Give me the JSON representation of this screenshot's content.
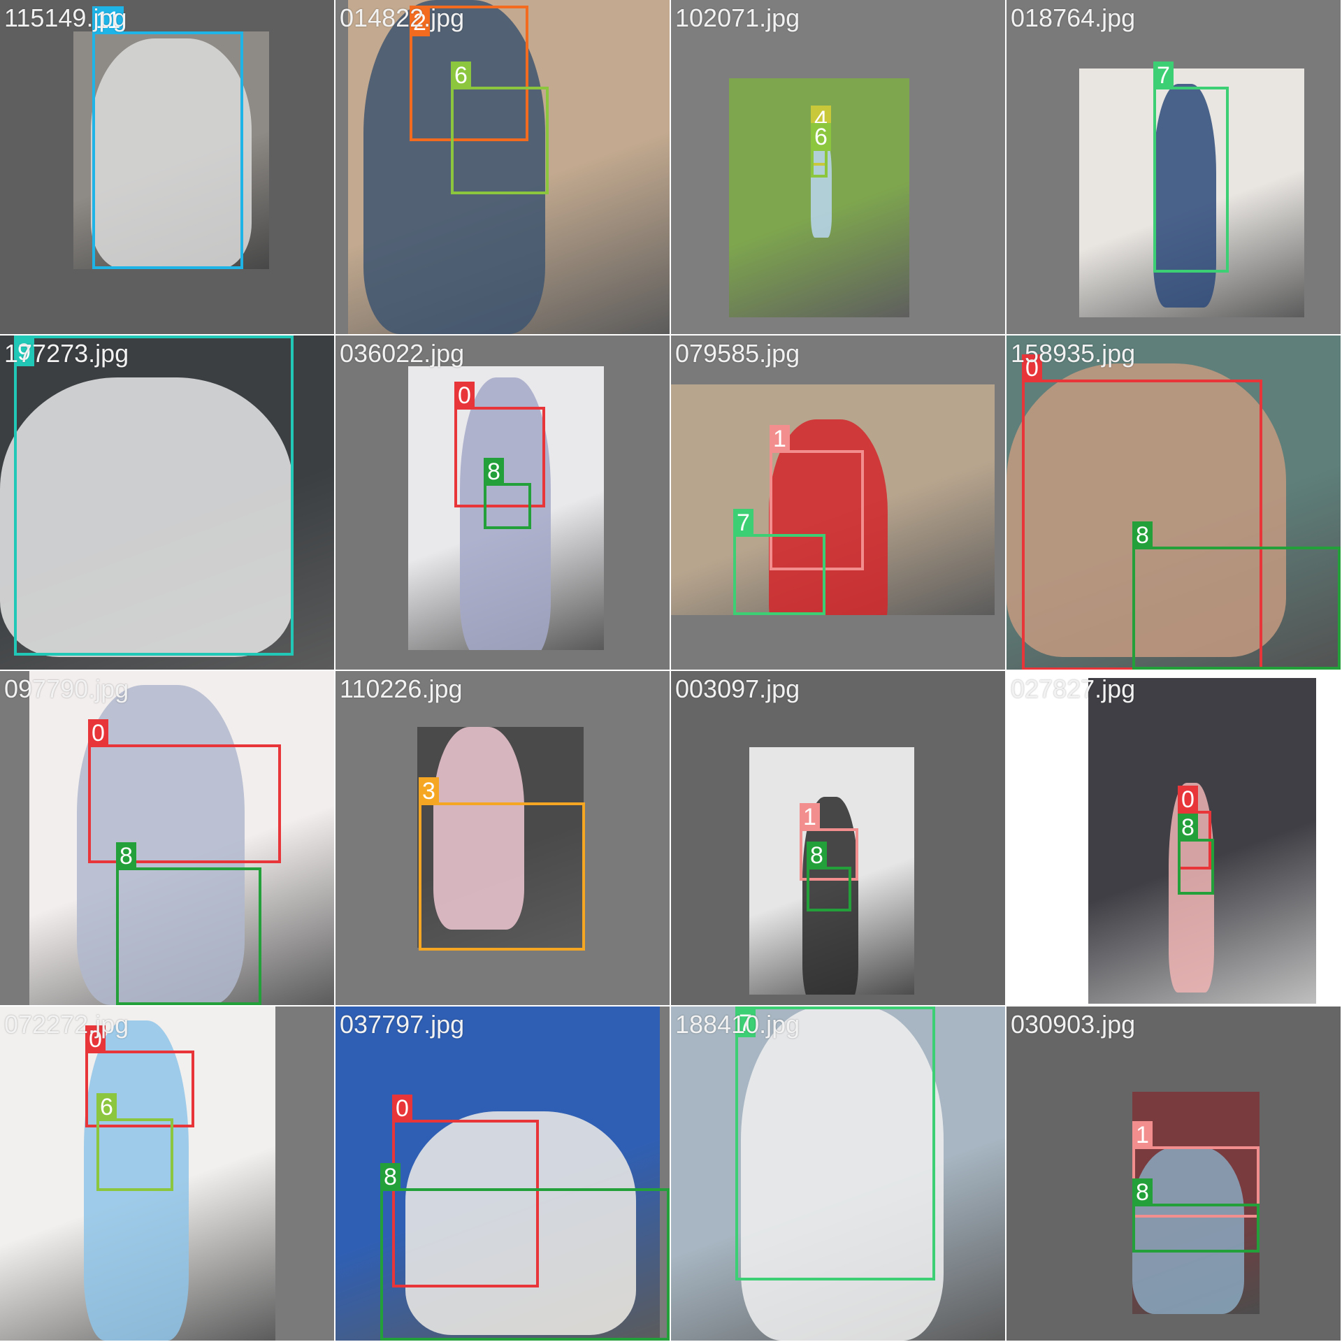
{
  "class_colors": {
    "0": "#e8353a",
    "1": "#f28e8e",
    "2": "#f26b1f",
    "3": "#f5a623",
    "4": "#c8c83a",
    "6": "#8cc63f",
    "7": "#3ccf74",
    "8": "#23a03a",
    "9": "#21c8b8",
    "11": "#1eb4e8"
  },
  "tiles": [
    {
      "filename": "115149.jpg",
      "bg": "#5f5f5f",
      "photo": {
        "bg": "#8e8a85",
        "accent": "#dcdcdc"
      },
      "detections": [
        {
          "class_id": "11",
          "label": "11"
        }
      ]
    },
    {
      "filename": "014822.jpg",
      "bg": "#7a7a7a",
      "photo": {
        "bg": "#c2a98f",
        "accent": "#3e5570"
      },
      "detections": [
        {
          "class_id": "2",
          "label": "2"
        },
        {
          "class_id": "6",
          "label": "6"
        }
      ]
    },
    {
      "filename": "102071.jpg",
      "bg": "#7e7e7e",
      "photo": {
        "bg": "#7ea64e",
        "accent": "#b9d6ef"
      },
      "detections": [
        {
          "class_id": "4",
          "label": "4"
        },
        {
          "class_id": "6",
          "label": "6"
        }
      ]
    },
    {
      "filename": "018764.jpg",
      "bg": "#7a7a7a",
      "photo": {
        "bg": "#e9e6e2",
        "accent": "#2d4a7a"
      },
      "detections": [
        {
          "class_id": "7",
          "label": "7"
        }
      ]
    },
    {
      "filename": "177273.jpg",
      "bg": "#7a7a7a",
      "photo": {
        "bg": "#3b3f42",
        "accent": "#e8e8e8"
      },
      "detections": [
        {
          "class_id": "9",
          "label": "9"
        }
      ]
    },
    {
      "filename": "036022.jpg",
      "bg": "#777777",
      "photo": {
        "bg": "#e9e9ec",
        "accent": "#a5a8c8"
      },
      "detections": [
        {
          "class_id": "0",
          "label": "0"
        },
        {
          "class_id": "8",
          "label": "8"
        }
      ]
    },
    {
      "filename": "079585.jpg",
      "bg": "#7a7a7a",
      "photo": {
        "bg": "#b8a58e",
        "accent": "#d4262a"
      },
      "detections": [
        {
          "class_id": "1",
          "label": "1"
        },
        {
          "class_id": "7",
          "label": "7"
        }
      ]
    },
    {
      "filename": "158935.jpg",
      "bg": "#6e6e6e",
      "photo": {
        "bg": "#5e7f7a",
        "accent": "#c49a80"
      },
      "detections": [
        {
          "class_id": "0",
          "label": "0"
        },
        {
          "class_id": "8",
          "label": "8"
        }
      ]
    },
    {
      "filename": "097790.jpg",
      "bg": "#7a7a7a",
      "photo": {
        "bg": "#f3eeee",
        "accent": "#b0b8cc"
      },
      "detections": [
        {
          "class_id": "0",
          "label": "0"
        },
        {
          "class_id": "8",
          "label": "8"
        }
      ]
    },
    {
      "filename": "110226.jpg",
      "bg": "#7a7a7a",
      "photo": {
        "bg": "#4a4a4a",
        "accent": "#f0c8d4"
      },
      "detections": [
        {
          "class_id": "3",
          "label": "3"
        }
      ]
    },
    {
      "filename": "003097.jpg",
      "bg": "#666666",
      "photo": {
        "bg": "#e6e6e6",
        "accent": "#2a2a2a"
      },
      "detections": [
        {
          "class_id": "1",
          "label": "1"
        },
        {
          "class_id": "8",
          "label": "8"
        }
      ]
    },
    {
      "filename": "027827.jpg",
      "bg": "#ffffff",
      "photo": {
        "bg": "#3f3f45",
        "accent": "#f0b4b4"
      },
      "detections": [
        {
          "class_id": "0",
          "label": "0"
        },
        {
          "class_id": "8",
          "label": "8"
        }
      ]
    },
    {
      "filename": "072272.jpg",
      "bg": "#7a7a7a",
      "photo": {
        "bg": "#f2f0ee",
        "accent": "#8fc4e8"
      },
      "detections": [
        {
          "class_id": "0",
          "label": "0"
        },
        {
          "class_id": "6",
          "label": "6"
        }
      ]
    },
    {
      "filename": "037797.jpg",
      "bg": "#7a7a7a",
      "photo": {
        "bg": "#2f5fb4",
        "accent": "#f0ece6"
      },
      "detections": [
        {
          "class_id": "0",
          "label": "0"
        },
        {
          "class_id": "8",
          "label": "8"
        }
      ]
    },
    {
      "filename": "188410.jpg",
      "bg": "#7a7a7a",
      "photo": {
        "bg": "#a7b6c2",
        "accent": "#f0f0f0"
      },
      "detections": [
        {
          "class_id": "7",
          "label": "7"
        }
      ]
    },
    {
      "filename": "030903.jpg",
      "bg": "#666666",
      "photo": {
        "bg": "#7a3b3f",
        "accent": "#8aa8c0"
      },
      "detections": [
        {
          "class_id": "1",
          "label": "1"
        },
        {
          "class_id": "8",
          "label": "8"
        }
      ]
    }
  ]
}
